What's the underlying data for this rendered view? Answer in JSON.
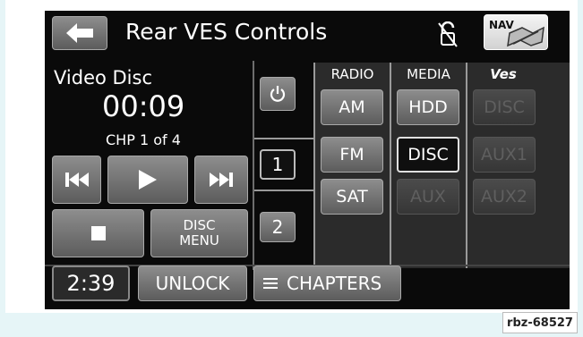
{
  "header": {
    "title": "Rear VES Controls",
    "back_icon": "back-arrow-icon",
    "lock_icon": "unlocked-padlock-icon",
    "nav_label": "NAV"
  },
  "player": {
    "source": "Video Disc",
    "time": "00:09",
    "chapter": "CHP 1 of 4",
    "disc_menu_line1": "DISC",
    "disc_menu_line2": "MENU"
  },
  "screens": {
    "power_icon": "power-icon",
    "screen1": "1",
    "screen2": "2"
  },
  "matrix": {
    "col_radio": "RADIO",
    "col_media": "MEDIA",
    "col_ves": "Ves",
    "radio": [
      "AM",
      "FM",
      "SAT"
    ],
    "media": [
      "HDD",
      "DISC",
      "AUX"
    ],
    "ves": [
      "DISC",
      "AUX1",
      "AUX2"
    ]
  },
  "footer": {
    "clock": "2:39",
    "unlock": "UNLOCK",
    "chapters": "CHAPTERS"
  },
  "badge": "rbz-68527"
}
